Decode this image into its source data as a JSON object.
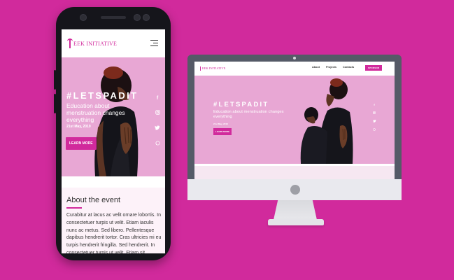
{
  "mobile": {
    "logo_text": "EEK INITIATIVE",
    "hero": {
      "hashtag": "#LETSPADIT",
      "subtitle": "Education about menstruation changes everything",
      "date": "21st May, 2019",
      "cta": "LEARN MORE"
    },
    "social_icons": [
      "facebook-icon",
      "instagram-icon",
      "twitter-icon",
      "whatsapp-icon"
    ],
    "about": {
      "title": "About the event",
      "text": "Curabitur at lacus ac velit ornare lobortis. In consectetuer turpis ut velit. Etiam iaculis nunc ac metus. Sed libero. Pellentesque dapibus hendrerit tortor. Cras ultricies mi eu turpis hendrerit fringilla. Sed hendrerit. In consectetuer turpis ut velit. Etiam sit"
    }
  },
  "desktop": {
    "logo_text": "EEK INITIATIVE",
    "nav": [
      "About",
      "Projects",
      "Contacts"
    ],
    "sponsor_label": "SPONSOR",
    "hero": {
      "hashtag": "#LETSPADIT",
      "subtitle": "Education about menstruation changes everything",
      "date": "21st May, 2019",
      "cta": "LEARN MORE"
    },
    "social_icons": [
      "facebook-icon",
      "instagram-icon",
      "twitter-icon",
      "whatsapp-icon"
    ]
  },
  "colors": {
    "background": "#d12a9c",
    "accent": "#d12a9c",
    "hero_pink": "#e8a7d4",
    "monitor_bezel": "#555a67"
  }
}
